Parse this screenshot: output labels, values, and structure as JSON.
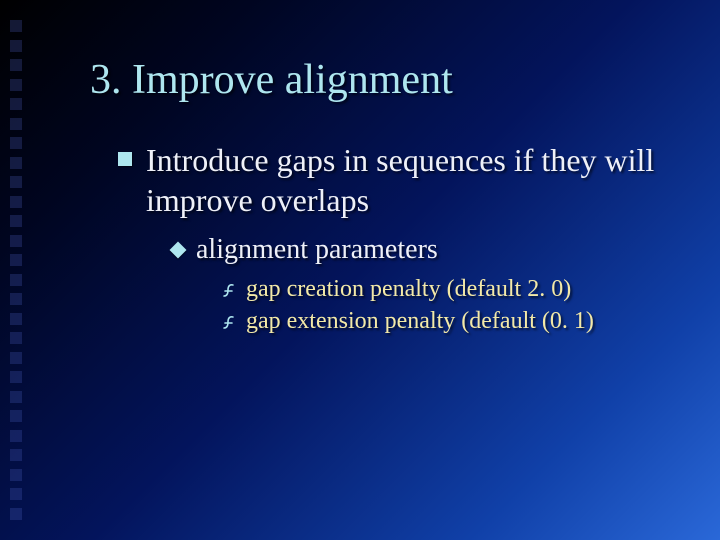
{
  "title": "3. Improve alignment",
  "lvl1": {
    "text": "Introduce gaps in sequences if they will improve overlaps"
  },
  "lvl2": {
    "text": "alignment parameters"
  },
  "lvl3a": {
    "text": "gap creation penalty (default 2. 0)"
  },
  "lvl3b": {
    "text": "gap extension penalty (default (0. 1)"
  }
}
